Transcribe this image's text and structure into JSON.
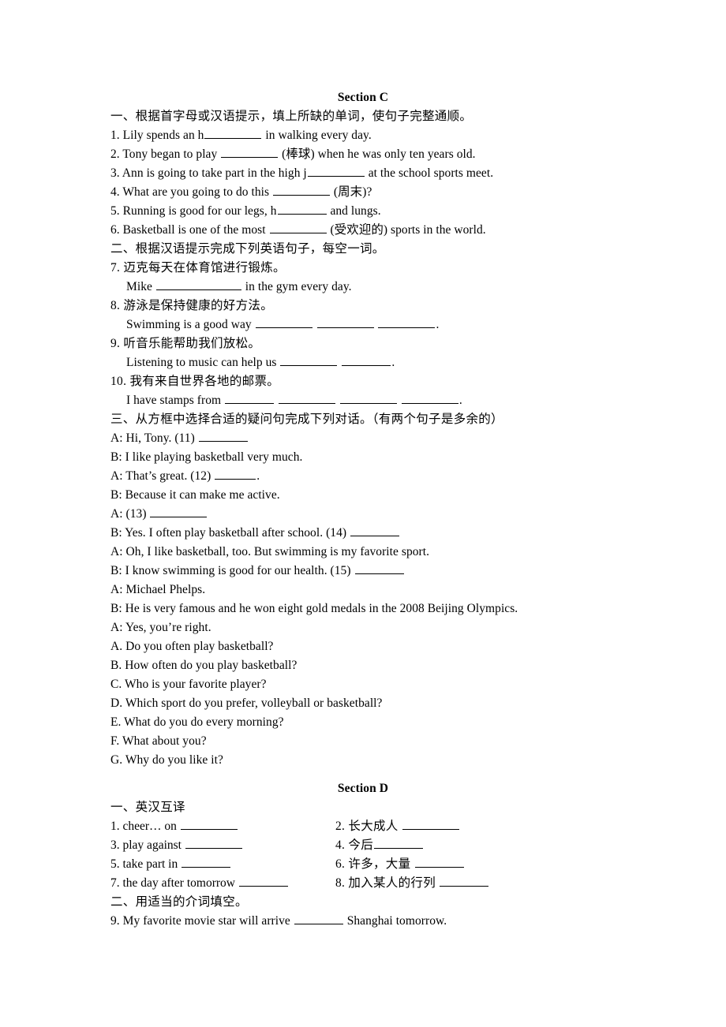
{
  "document": {
    "sections": [
      {
        "id": "section-c",
        "title": "Section C",
        "parts": [
          {
            "id": "part-c-1",
            "heading": "一、根据首字母或汉语提示，填上所缺的单词，使句子完整通顺。",
            "lines": [
              {
                "id": "c1-q1",
                "pre": "1. Lily spends an h",
                "blank": "b-lg",
                "post": " in walking every day."
              },
              {
                "id": "c1-q2",
                "pre": "2. Tony began to play ",
                "blank": "b-lg",
                "post": " (棒球) when he was only ten years old."
              },
              {
                "id": "c1-q3",
                "pre": "3. Ann is going to take part in the high j",
                "blank": "b-lg",
                "post": " at the school sports meet."
              },
              {
                "id": "c1-q4",
                "pre": "4. What are you going to do this ",
                "blank": "b-lg",
                "post": " (周末)?"
              },
              {
                "id": "c1-q5",
                "pre": "5. Running is good for our legs, h",
                "blank": "b-md",
                "post": " and lungs."
              },
              {
                "id": "c1-q6",
                "pre": "6. Basketball is one of the most ",
                "blank": "b-lg",
                "post": " (受欢迎的) sports in the world."
              }
            ]
          },
          {
            "id": "part-c-2",
            "heading": "二、根据汉语提示完成下列英语句子，每空一词。",
            "lines": [
              {
                "id": "c2-q7",
                "pre": "7. 迈克每天在体育馆进行锻炼。",
                "blank": null,
                "post": "",
                "cn": true
              },
              {
                "id": "c2-q7a",
                "pre": "Mike ",
                "blank": "b-xxl",
                "post": " in the gym every day.",
                "indent": true
              },
              {
                "id": "c2-q8",
                "pre": "8. 游泳是保持健康的好方法。",
                "blank": null,
                "post": "",
                "cn": true
              },
              {
                "id": "c2-q8a",
                "pre": "Swimming is a good way ",
                "blank": "b-lg",
                "blank2": "b-lg",
                "blank3": "b-lg",
                "post": ".",
                "indent": true
              },
              {
                "id": "c2-q9",
                "pre": "9. 听音乐能帮助我们放松。",
                "blank": null,
                "post": "",
                "cn": true
              },
              {
                "id": "c2-q9a",
                "pre": "Listening to music can help us ",
                "blank": "b-lg",
                "blank2": "b-md",
                "post": ".",
                "indent": true
              },
              {
                "id": "c2-q10",
                "pre": "10. 我有来自世界各地的邮票。",
                "blank": null,
                "post": "",
                "cn": true
              },
              {
                "id": "c2-q10a",
                "pre": "I have stamps from ",
                "blank": "b-md",
                "blank2": "b-lg",
                "blank3": "b-lg",
                "blank4": "b-lg",
                "post": ".",
                "indent": true
              }
            ]
          },
          {
            "id": "part-c-3",
            "heading": "三、从方框中选择合适的疑问句完成下列对话。（有两个句子是多余的）",
            "lines": [
              {
                "id": "c3-d1",
                "pre": "A: Hi, Tony. (11) ",
                "blank": "b-md",
                "post": ""
              },
              {
                "id": "c3-d2",
                "pre": "B: I like playing basketball very much.",
                "blank": null,
                "post": ""
              },
              {
                "id": "c3-d3",
                "pre": "A: That’s great. (12) ",
                "blank": "b-sm",
                "post": "."
              },
              {
                "id": "c3-d4",
                "pre": "B: Because it can make me active.",
                "blank": null,
                "post": ""
              },
              {
                "id": "c3-d5",
                "pre": "A: (13) ",
                "blank": "b-lg",
                "post": ""
              },
              {
                "id": "c3-d6",
                "pre": "B: Yes. I often play basketball after school. (14) ",
                "blank": "b-md",
                "post": ""
              },
              {
                "id": "c3-d7",
                "pre": "A: Oh, I like basketball, too. But swimming is my favorite sport.",
                "blank": null,
                "post": ""
              },
              {
                "id": "c3-d8",
                "pre": "B: I know swimming is good for our health. (15) ",
                "blank": "b-md",
                "post": ""
              },
              {
                "id": "c3-d9",
                "pre": "A: Michael Phelps.",
                "blank": null,
                "post": ""
              },
              {
                "id": "c3-d10",
                "pre": "B: He is very famous and he won eight gold medals in the 2008 Beijing Olympics.",
                "blank": null,
                "post": ""
              },
              {
                "id": "c3-d11",
                "pre": "A: Yes, you’re right.",
                "blank": null,
                "post": ""
              },
              {
                "id": "c3-opt-a",
                "pre": "A. Do you often play basketball?",
                "blank": null,
                "post": ""
              },
              {
                "id": "c3-opt-b",
                "pre": "B. How often do you play basketball?",
                "blank": null,
                "post": ""
              },
              {
                "id": "c3-opt-c",
                "pre": "C. Who is your favorite player?",
                "blank": null,
                "post": ""
              },
              {
                "id": "c3-opt-d",
                "pre": "D. Which sport do you prefer, volleyball or basketball?",
                "blank": null,
                "post": ""
              },
              {
                "id": "c3-opt-e",
                "pre": "E. What do you do every morning?",
                "blank": null,
                "post": ""
              },
              {
                "id": "c3-opt-f",
                "pre": "F. What about you?",
                "blank": null,
                "post": ""
              },
              {
                "id": "c3-opt-g",
                "pre": "G. Why do you like it?",
                "blank": null,
                "post": ""
              }
            ]
          }
        ]
      },
      {
        "id": "section-d",
        "title": "Section D",
        "parts": [
          {
            "id": "part-d-1",
            "heading": "一、英汉互译",
            "pairs": [
              {
                "left": {
                  "id": "d1-q1",
                  "text": "1. cheer… on ",
                  "blank": "b-lg"
                },
                "right": {
                  "id": "d1-q2",
                  "text": "2. 长大成人 ",
                  "blank": "b-lg",
                  "cn": true
                }
              },
              {
                "left": {
                  "id": "d1-q3",
                  "text": "3. play against ",
                  "blank": "b-lg"
                },
                "right": {
                  "id": "d1-q4",
                  "text": "4. 今后",
                  "blank": "b-md",
                  "cn": true
                }
              },
              {
                "left": {
                  "id": "d1-q5",
                  "text": "5. take part in ",
                  "blank": "b-md"
                },
                "right": {
                  "id": "d1-q6",
                  "text": "6. 许多，大量 ",
                  "blank": "b-md",
                  "cn": true
                }
              },
              {
                "left": {
                  "id": "d1-q7",
                  "text": "7. the day after tomorrow ",
                  "blank": "b-md"
                },
                "right": {
                  "id": "d1-q8",
                  "text": "8. 加入某人的行列 ",
                  "blank": "b-md",
                  "cn": true
                }
              }
            ]
          },
          {
            "id": "part-d-2",
            "heading": "二、用适当的介词填空。",
            "lines": [
              {
                "id": "d2-q9",
                "pre": "9. My favorite movie star will arrive ",
                "blank": "b-md",
                "post": " Shanghai tomorrow."
              }
            ]
          }
        ]
      }
    ]
  }
}
